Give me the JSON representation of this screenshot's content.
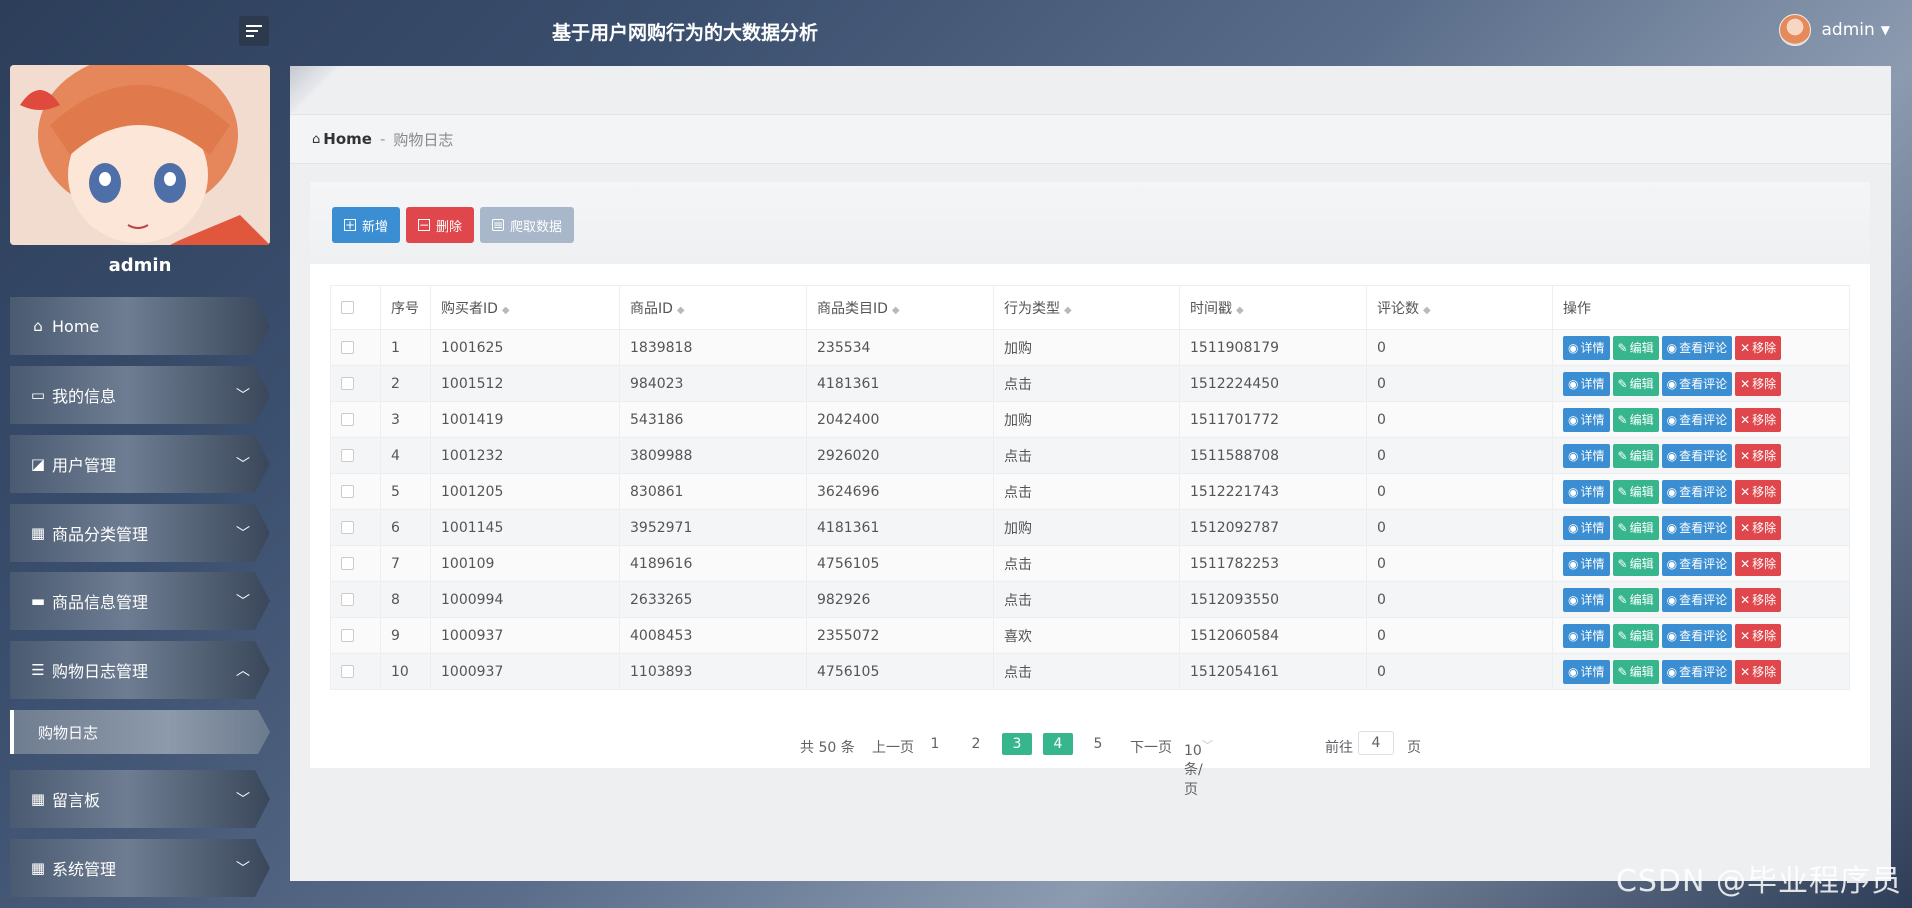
{
  "header": {
    "title": "基于用户网购行为的大数据分析",
    "username": "admin"
  },
  "sidebar": {
    "profile_name": "admin",
    "items": [
      {
        "label": "Home",
        "icon": "home-icon"
      },
      {
        "label": "我的信息",
        "icon": "id-card-icon"
      },
      {
        "label": "用户管理",
        "icon": "chart-icon"
      },
      {
        "label": "商品分类管理",
        "icon": "grid-icon"
      },
      {
        "label": "商品信息管理",
        "icon": "tray-icon"
      },
      {
        "label": "购物日志管理",
        "icon": "list-icon"
      },
      {
        "label": "留言板",
        "icon": "grid-icon"
      },
      {
        "label": "系统管理",
        "icon": "grid-icon"
      }
    ],
    "sub_item": "购物日志"
  },
  "breadcrumb": {
    "home": "Home",
    "sep": "-",
    "current": "购物日志"
  },
  "toolbar": {
    "add": "新增",
    "delete": "删除",
    "crawl": "爬取数据"
  },
  "table": {
    "headers": [
      "序号",
      "购买者ID",
      "商品ID",
      "商品类目ID",
      "行为类型",
      "时间戳",
      "评论数",
      "操作"
    ],
    "rows": [
      [
        "1",
        "1001625",
        "1839818",
        "235534",
        "加购",
        "1511908179",
        "0"
      ],
      [
        "2",
        "1001512",
        "984023",
        "4181361",
        "点击",
        "1512224450",
        "0"
      ],
      [
        "3",
        "1001419",
        "543186",
        "2042400",
        "加购",
        "1511701772",
        "0"
      ],
      [
        "4",
        "1001232",
        "3809988",
        "2926020",
        "点击",
        "1511588708",
        "0"
      ],
      [
        "5",
        "1001205",
        "830861",
        "3624696",
        "点击",
        "1512221743",
        "0"
      ],
      [
        "6",
        "1001145",
        "3952971",
        "4181361",
        "加购",
        "1512092787",
        "0"
      ],
      [
        "7",
        "100109",
        "4189616",
        "4756105",
        "点击",
        "1511782253",
        "0"
      ],
      [
        "8",
        "1000994",
        "2633265",
        "982926",
        "点击",
        "1512093550",
        "0"
      ],
      [
        "9",
        "1000937",
        "4008453",
        "2355072",
        "喜欢",
        "1512060584",
        "0"
      ],
      [
        "10",
        "1000937",
        "1103893",
        "4756105",
        "点击",
        "1512054161",
        "0"
      ]
    ],
    "actions": {
      "detail": "详情",
      "edit": "编辑",
      "review": "查看评论",
      "remove": "移除"
    }
  },
  "pagination": {
    "total": "共 50 条",
    "prev": "上一页",
    "pages": [
      "1",
      "2",
      "3",
      "4",
      "5"
    ],
    "current": "4",
    "next": "下一页",
    "page_size": "10条/页",
    "goto_label": "前往",
    "goto_value": "4",
    "goto_suffix": "页"
  },
  "watermark": "CSDN @毕业程序员",
  "colors": {
    "primary": "#3b8ed2",
    "success": "#37b68d",
    "danger": "#e0474c"
  }
}
